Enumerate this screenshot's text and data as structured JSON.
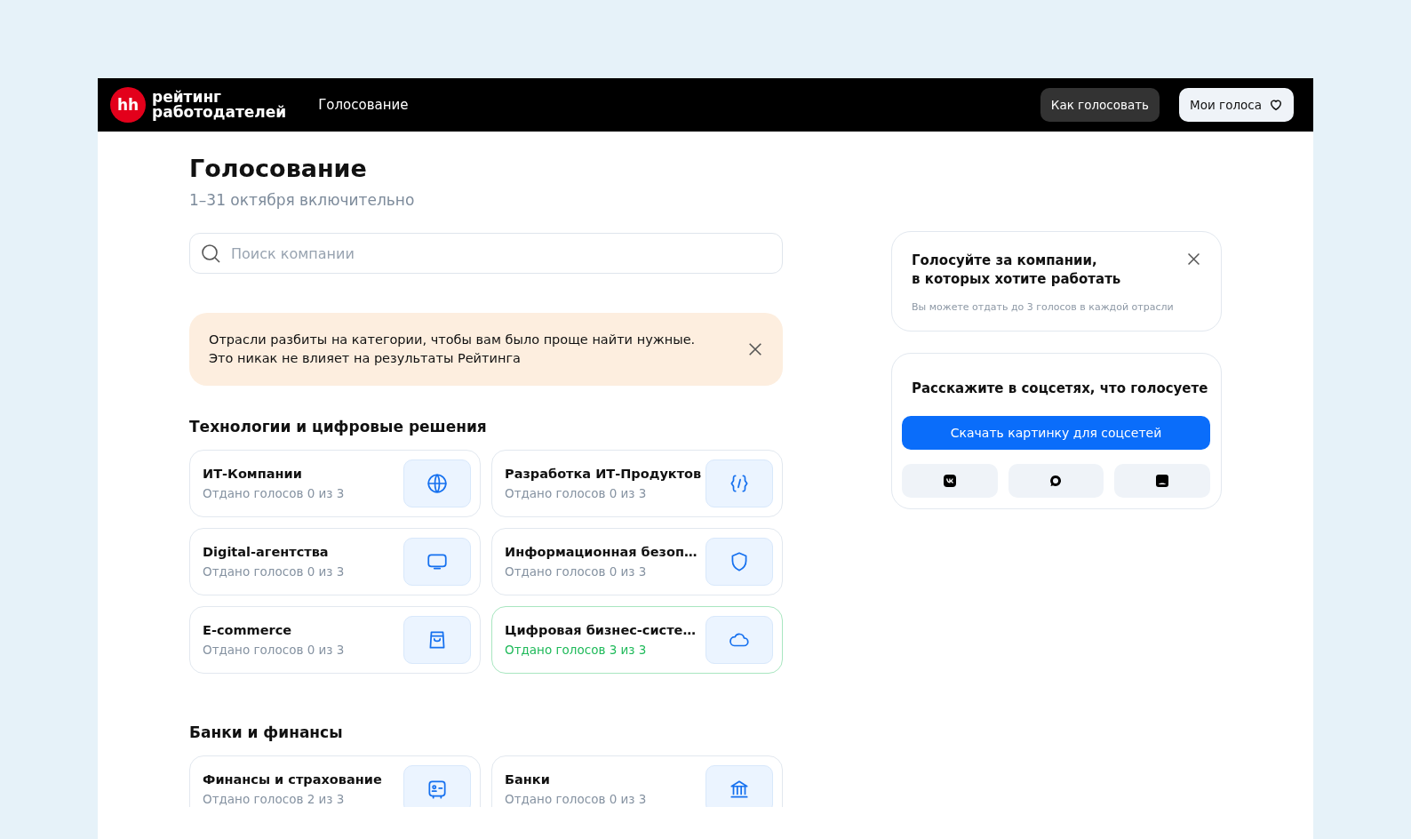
{
  "header": {
    "logo_mark": "hh",
    "logo_text": [
      "рейтинг",
      "работодателей"
    ],
    "nav": "Голосование",
    "buttons": {
      "how": "Как голосовать",
      "my_votes": "Мои голоса"
    }
  },
  "page": {
    "title": "Голосование",
    "subtitle": "1–31 октября включительно"
  },
  "search": {
    "placeholder": "Поиск компании"
  },
  "notice": {
    "lines": [
      "Отрасли разбиты на категории, чтобы вам было проще найти нужные.",
      "Это никак не влияет на результаты Рейтинга"
    ]
  },
  "sections": [
    {
      "title": "Технологии и цифровые решения",
      "cards": [
        {
          "name": "ИТ-Компании",
          "votes": "Отдано голосов 0 из 3",
          "complete": false,
          "kind": "globe"
        },
        {
          "name": "Разработка ИТ-Продуктов",
          "votes": "Отдано голосов 0 из 3",
          "complete": false,
          "kind": "code"
        },
        {
          "name": "Digital-агентства",
          "votes": "Отдано голосов 0 из 3",
          "complete": false,
          "kind": "monitor"
        },
        {
          "name": "Информационная безоп…",
          "votes": "Отдано голосов 0 из 3",
          "complete": false,
          "kind": "shield"
        },
        {
          "name": "E-commerce",
          "votes": "Отдано голосов 0 из 3",
          "complete": false,
          "kind": "bag"
        },
        {
          "name": "Цифровая бизнес-систе…",
          "votes": "Отдано голосов 3 из 3",
          "complete": true,
          "kind": "cloud"
        }
      ]
    },
    {
      "title": "Банки и финансы",
      "cards": [
        {
          "name": "Финансы и страхование",
          "votes": "Отдано голосов 2 из 3",
          "complete": false,
          "kind": "safe"
        },
        {
          "name": "Банки",
          "votes": "Отдано голосов 0 из 3",
          "complete": false,
          "kind": "bank"
        }
      ]
    }
  ],
  "info_card": {
    "title_lines": [
      "Голосуйте за компании,",
      "в которых хотите работать"
    ],
    "note": "Вы можете отдать до 3 голосов в каждой отрасли"
  },
  "share_card": {
    "title": "Расскажите в соцсетях, что голосуете",
    "button": "Скачать картинку для соцсетей",
    "networks": [
      {
        "kind": "vk"
      },
      {
        "kind": "chat"
      },
      {
        "kind": "square"
      }
    ]
  }
}
